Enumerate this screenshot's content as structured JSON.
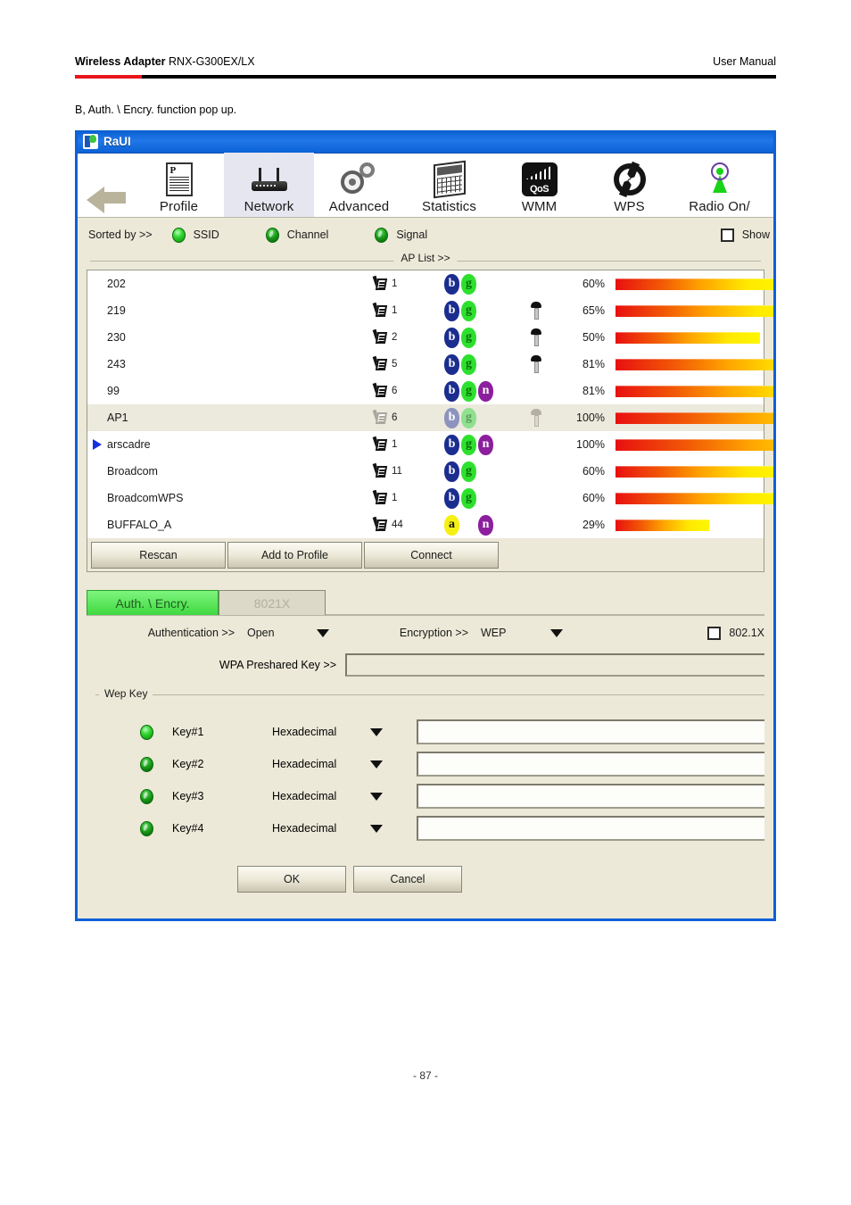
{
  "doc": {
    "header_left_bold": "Wireless Adapter",
    "header_left_model": " RNX-G300EX/LX",
    "header_right": "User Manual",
    "caption": "B, Auth. \\ Encry. function pop up.",
    "page_number": "- 87 -",
    "accent_red": "#e8161b"
  },
  "window": {
    "title": "RaUI",
    "title_icon": "raui-logo-icon",
    "titlebar_color": "#1060d8"
  },
  "toolbar": {
    "back_icon": "back-arrow-icon",
    "items": [
      {
        "label": "Profile",
        "icon": "profile-document-icon",
        "active": false
      },
      {
        "label": "Network",
        "icon": "router-icon",
        "active": true
      },
      {
        "label": "Advanced",
        "icon": "gears-icon",
        "active": false
      },
      {
        "label": "Statistics",
        "icon": "statistics-chart-icon",
        "active": false
      },
      {
        "label": "WMM",
        "icon": "qos-icon",
        "active": false
      },
      {
        "label": "WPS",
        "icon": "wps-icon",
        "active": false
      },
      {
        "label": "Radio On/",
        "icon": "radio-antenna-icon",
        "active": false
      }
    ]
  },
  "sortbar": {
    "label": "Sorted by >>",
    "options": [
      {
        "label": "SSID",
        "selected": true
      },
      {
        "label": "Channel",
        "selected": false
      },
      {
        "label": "Signal",
        "selected": false
      }
    ],
    "show_checkbox_label": "Show",
    "show_checked": false,
    "aplist_caption": "AP List >>"
  },
  "ap_list": {
    "rows": [
      {
        "ssid": "202",
        "channel": "1",
        "modes": [
          "b",
          "g"
        ],
        "locked": false,
        "signal": "60%",
        "signal_pct": 60,
        "selected": false,
        "marker": false,
        "dimmed": false
      },
      {
        "ssid": "219",
        "channel": "1",
        "modes": [
          "b",
          "g"
        ],
        "locked": true,
        "signal": "65%",
        "signal_pct": 65,
        "selected": false,
        "marker": false,
        "dimmed": false
      },
      {
        "ssid": "230",
        "channel": "2",
        "modes": [
          "b",
          "g"
        ],
        "locked": true,
        "signal": "50%",
        "signal_pct": 50,
        "selected": false,
        "marker": false,
        "dimmed": false
      },
      {
        "ssid": "243",
        "channel": "5",
        "modes": [
          "b",
          "g"
        ],
        "locked": true,
        "signal": "81%",
        "signal_pct": 81,
        "selected": false,
        "marker": false,
        "dimmed": false
      },
      {
        "ssid": "99",
        "channel": "6",
        "modes": [
          "b",
          "g",
          "n"
        ],
        "locked": false,
        "signal": "81%",
        "signal_pct": 81,
        "selected": false,
        "marker": false,
        "dimmed": false
      },
      {
        "ssid": "AP1",
        "channel": "6",
        "modes": [
          "b",
          "g"
        ],
        "locked": true,
        "signal": "100%",
        "signal_pct": 100,
        "selected": true,
        "marker": false,
        "dimmed": true
      },
      {
        "ssid": "arscadre",
        "channel": "1",
        "modes": [
          "b",
          "g",
          "n"
        ],
        "locked": false,
        "signal": "100%",
        "signal_pct": 100,
        "selected": false,
        "marker": true,
        "dimmed": false
      },
      {
        "ssid": "Broadcom",
        "channel": "11",
        "modes": [
          "b",
          "g"
        ],
        "locked": false,
        "signal": "60%",
        "signal_pct": 60,
        "selected": false,
        "marker": false,
        "dimmed": false
      },
      {
        "ssid": "BroadcomWPS",
        "channel": "1",
        "modes": [
          "b",
          "g"
        ],
        "locked": false,
        "signal": "60%",
        "signal_pct": 60,
        "selected": false,
        "marker": false,
        "dimmed": false
      },
      {
        "ssid": "BUFFALO_A",
        "channel": "44",
        "modes": [
          "a",
          "-",
          "n"
        ],
        "locked": false,
        "signal": "29%",
        "signal_pct": 29,
        "selected": false,
        "marker": false,
        "dimmed": false
      }
    ],
    "buttons": [
      {
        "label": "Rescan"
      },
      {
        "label": "Add to Profile"
      },
      {
        "label": "Connect"
      }
    ]
  },
  "auth_panel": {
    "tabs": [
      {
        "label": "Auth. \\ Encry.",
        "active": true,
        "disabled": false
      },
      {
        "label": "8021X",
        "active": false,
        "disabled": true
      }
    ],
    "authentication_label": "Authentication >>",
    "authentication_value": "Open",
    "encryption_label": "Encryption >>",
    "encryption_value": "WEP",
    "dot1x_label": "802.1X",
    "dot1x_checked": false,
    "psk_label": "WPA Preshared Key >>",
    "psk_value": "",
    "wep_legend": "Wep Key",
    "wep_keys": [
      {
        "name": "Key#1",
        "format": "Hexadecimal",
        "value": "",
        "selected": true
      },
      {
        "name": "Key#2",
        "format": "Hexadecimal",
        "value": "",
        "selected": false
      },
      {
        "name": "Key#3",
        "format": "Hexadecimal",
        "value": "",
        "selected": false
      },
      {
        "name": "Key#4",
        "format": "Hexadecimal",
        "value": "",
        "selected": false
      }
    ],
    "ok_label": "OK",
    "cancel_label": "Cancel"
  }
}
